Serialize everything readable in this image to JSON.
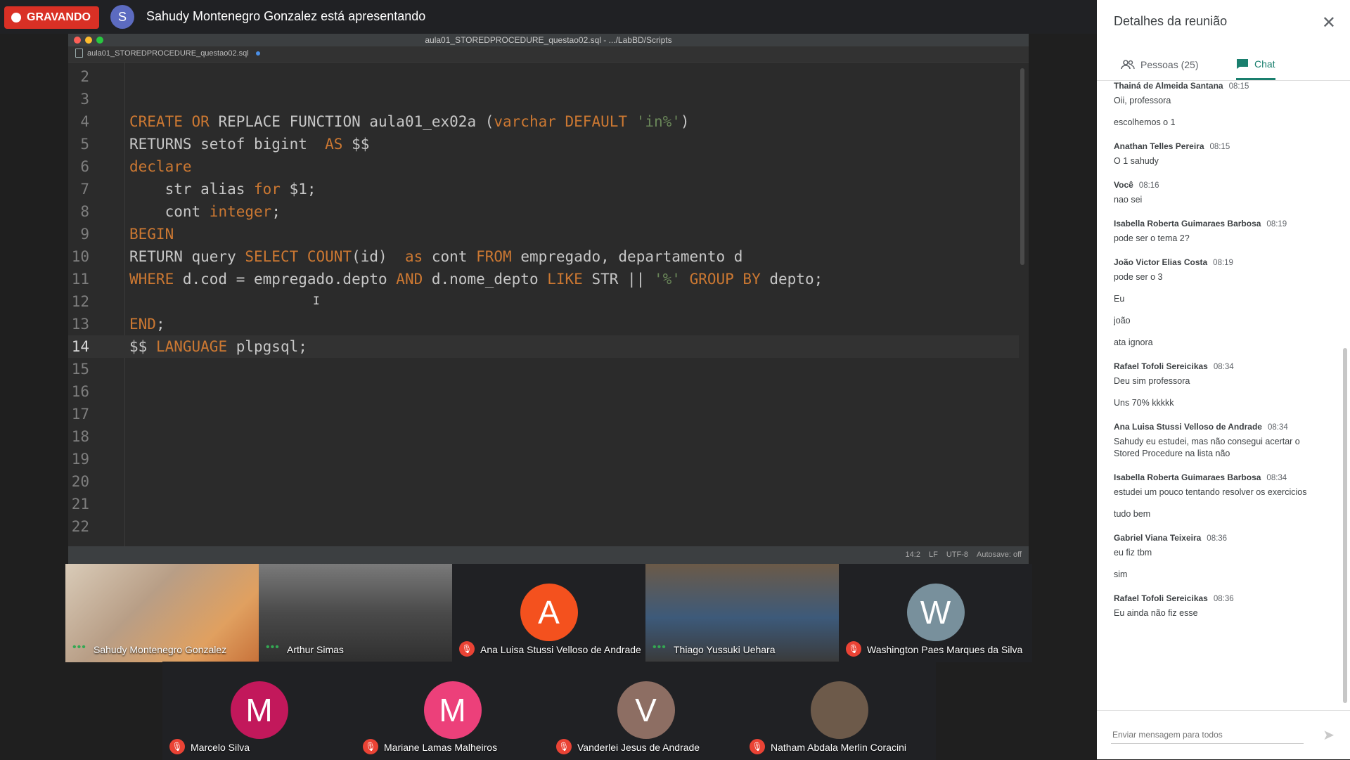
{
  "top_bar": {
    "recording_label": "GRAVANDO",
    "presenter_initial": "S",
    "presenter_text": "Sahudy Montenegro Gonzalez está apresentando"
  },
  "editor": {
    "window_title": "aula01_STOREDPROCEDURE_questao02.sql - .../LabBD/Scripts",
    "tab_label": "aula01_STOREDPROCEDURE_questao02.sql",
    "lines": [
      {
        "n": "2",
        "tokens": []
      },
      {
        "n": "3",
        "tokens": []
      },
      {
        "n": "4",
        "tokens": [
          {
            "t": "CREATE OR",
            "c": "kw"
          },
          {
            "t": " REPLACE FUNCTION aula01_ex02a (",
            "c": ""
          },
          {
            "t": "varchar DEFAULT",
            "c": "kw"
          },
          {
            "t": " ",
            "c": ""
          },
          {
            "t": "'in%'",
            "c": "str"
          },
          {
            "t": ")",
            "c": ""
          }
        ]
      },
      {
        "n": "5",
        "tokens": [
          {
            "t": "RETURNS setof bigint  ",
            "c": ""
          },
          {
            "t": "AS",
            "c": "kw"
          },
          {
            "t": " $$",
            "c": ""
          }
        ]
      },
      {
        "n": "6",
        "tokens": [
          {
            "t": "declare",
            "c": "kw"
          }
        ]
      },
      {
        "n": "7",
        "tokens": [
          {
            "t": "    str alias ",
            "c": ""
          },
          {
            "t": "for",
            "c": "kw"
          },
          {
            "t": " $1;",
            "c": ""
          }
        ]
      },
      {
        "n": "8",
        "tokens": [
          {
            "t": "    cont ",
            "c": ""
          },
          {
            "t": "integer",
            "c": "kw"
          },
          {
            "t": ";",
            "c": ""
          }
        ]
      },
      {
        "n": "9",
        "tokens": [
          {
            "t": "BEGIN",
            "c": "kw"
          }
        ]
      },
      {
        "n": "10",
        "tokens": [
          {
            "t": "RETURN query ",
            "c": ""
          },
          {
            "t": "SELECT COUNT",
            "c": "kw"
          },
          {
            "t": "(id)  ",
            "c": ""
          },
          {
            "t": "as",
            "c": "kw"
          },
          {
            "t": " cont ",
            "c": ""
          },
          {
            "t": "FROM",
            "c": "kw"
          },
          {
            "t": " empregado, departamento d",
            "c": ""
          }
        ]
      },
      {
        "n": "11",
        "tokens": [
          {
            "t": "WHERE",
            "c": "kw"
          },
          {
            "t": " d.cod = empregado.depto ",
            "c": ""
          },
          {
            "t": "AND",
            "c": "kw"
          },
          {
            "t": " d.nome_depto ",
            "c": ""
          },
          {
            "t": "LIKE",
            "c": "kw"
          },
          {
            "t": " STR || ",
            "c": ""
          },
          {
            "t": "'%'",
            "c": "str"
          },
          {
            "t": " ",
            "c": ""
          },
          {
            "t": "GROUP BY",
            "c": "kw"
          },
          {
            "t": " depto;",
            "c": ""
          }
        ]
      },
      {
        "n": "12",
        "tokens": []
      },
      {
        "n": "13",
        "tokens": [
          {
            "t": "END",
            "c": "kw"
          },
          {
            "t": ";",
            "c": ""
          }
        ]
      },
      {
        "n": "14",
        "tokens": [
          {
            "t": "$$ ",
            "c": ""
          },
          {
            "t": "LANGUAGE",
            "c": "kw"
          },
          {
            "t": " plpgsql;",
            "c": ""
          }
        ],
        "active": true
      },
      {
        "n": "15",
        "tokens": []
      },
      {
        "n": "16",
        "tokens": []
      },
      {
        "n": "17",
        "tokens": []
      },
      {
        "n": "18",
        "tokens": []
      },
      {
        "n": "19",
        "tokens": []
      },
      {
        "n": "20",
        "tokens": []
      },
      {
        "n": "21",
        "tokens": []
      },
      {
        "n": "22",
        "tokens": []
      }
    ],
    "status": {
      "position": "14:2",
      "line_ending": "LF",
      "encoding": "UTF-8",
      "autosave": "Autosave: off"
    }
  },
  "participants_row1": [
    {
      "name": "Sahudy Montenegro Gonzalez",
      "type": "video",
      "status": "speaking"
    },
    {
      "name": "Arthur Simas",
      "type": "video",
      "status": "speaking"
    },
    {
      "name": "Ana Luisa Stussi Velloso de Andrade",
      "type": "avatar",
      "initial": "A",
      "color": "#f4511e",
      "status": "muted"
    },
    {
      "name": "Thiago Yussuki Uehara",
      "type": "video",
      "status": "speaking"
    },
    {
      "name": "Washington Paes Marques da Silva",
      "type": "avatar",
      "initial": "W",
      "color": "#78909c",
      "status": "muted"
    }
  ],
  "participants_row2": [
    {
      "name": "Marcelo Silva",
      "type": "avatar",
      "initial": "M",
      "color": "#c2185b",
      "status": "muted"
    },
    {
      "name": "Mariane Lamas Malheiros",
      "type": "avatar",
      "initial": "M",
      "color": "#ec407a",
      "status": "muted"
    },
    {
      "name": "Vanderlei Jesus de Andrade",
      "type": "avatar",
      "initial": "V",
      "color": "#8d6e63",
      "status": "muted"
    },
    {
      "name": "Natham Abdala Merlin Coracini",
      "type": "photo",
      "initial": "",
      "color": "#6d5a4a",
      "status": "muted"
    }
  ],
  "panel": {
    "title": "Detalhes da reunião",
    "tab_people": "Pessoas (25)",
    "tab_chat": "Chat",
    "input_placeholder": "Enviar mensagem para todos",
    "messages": [
      {
        "author": "Thainá de Almeida Santana",
        "time": "08:15",
        "lines": [
          "Oii, professora",
          "escolhemos o 1"
        ]
      },
      {
        "author": "Anathan Telles Pereira",
        "time": "08:15",
        "lines": [
          "O 1 sahudy"
        ]
      },
      {
        "author": "Você",
        "time": "08:16",
        "lines": [
          "nao sei"
        ]
      },
      {
        "author": "Isabella Roberta Guimaraes Barbosa",
        "time": "08:19",
        "lines": [
          "pode ser o tema 2?"
        ]
      },
      {
        "author": "João Victor Elias Costa",
        "time": "08:19",
        "lines": [
          "pode ser o 3",
          "Eu",
          "joão",
          "ata ignora"
        ]
      },
      {
        "author": "Rafael Tofoli Sereicikas",
        "time": "08:34",
        "lines": [
          "Deu sim professora",
          "Uns 70% kkkkk"
        ]
      },
      {
        "author": "Ana Luisa Stussi Velloso de Andrade",
        "time": "08:34",
        "lines": [
          "Sahudy eu estudei, mas não consegui acertar o Stored Procedure na lista não"
        ]
      },
      {
        "author": "Isabella Roberta Guimaraes Barbosa",
        "time": "08:34",
        "lines": [
          "estudei um pouco tentando resolver os exercicios",
          "tudo bem"
        ]
      },
      {
        "author": "Gabriel Viana Teixeira",
        "time": "08:36",
        "lines": [
          "eu fiz tbm",
          "sim"
        ]
      },
      {
        "author": "Rafael Tofoli Sereicikas",
        "time": "08:36",
        "lines": [
          "Eu ainda não fiz esse"
        ]
      }
    ]
  }
}
